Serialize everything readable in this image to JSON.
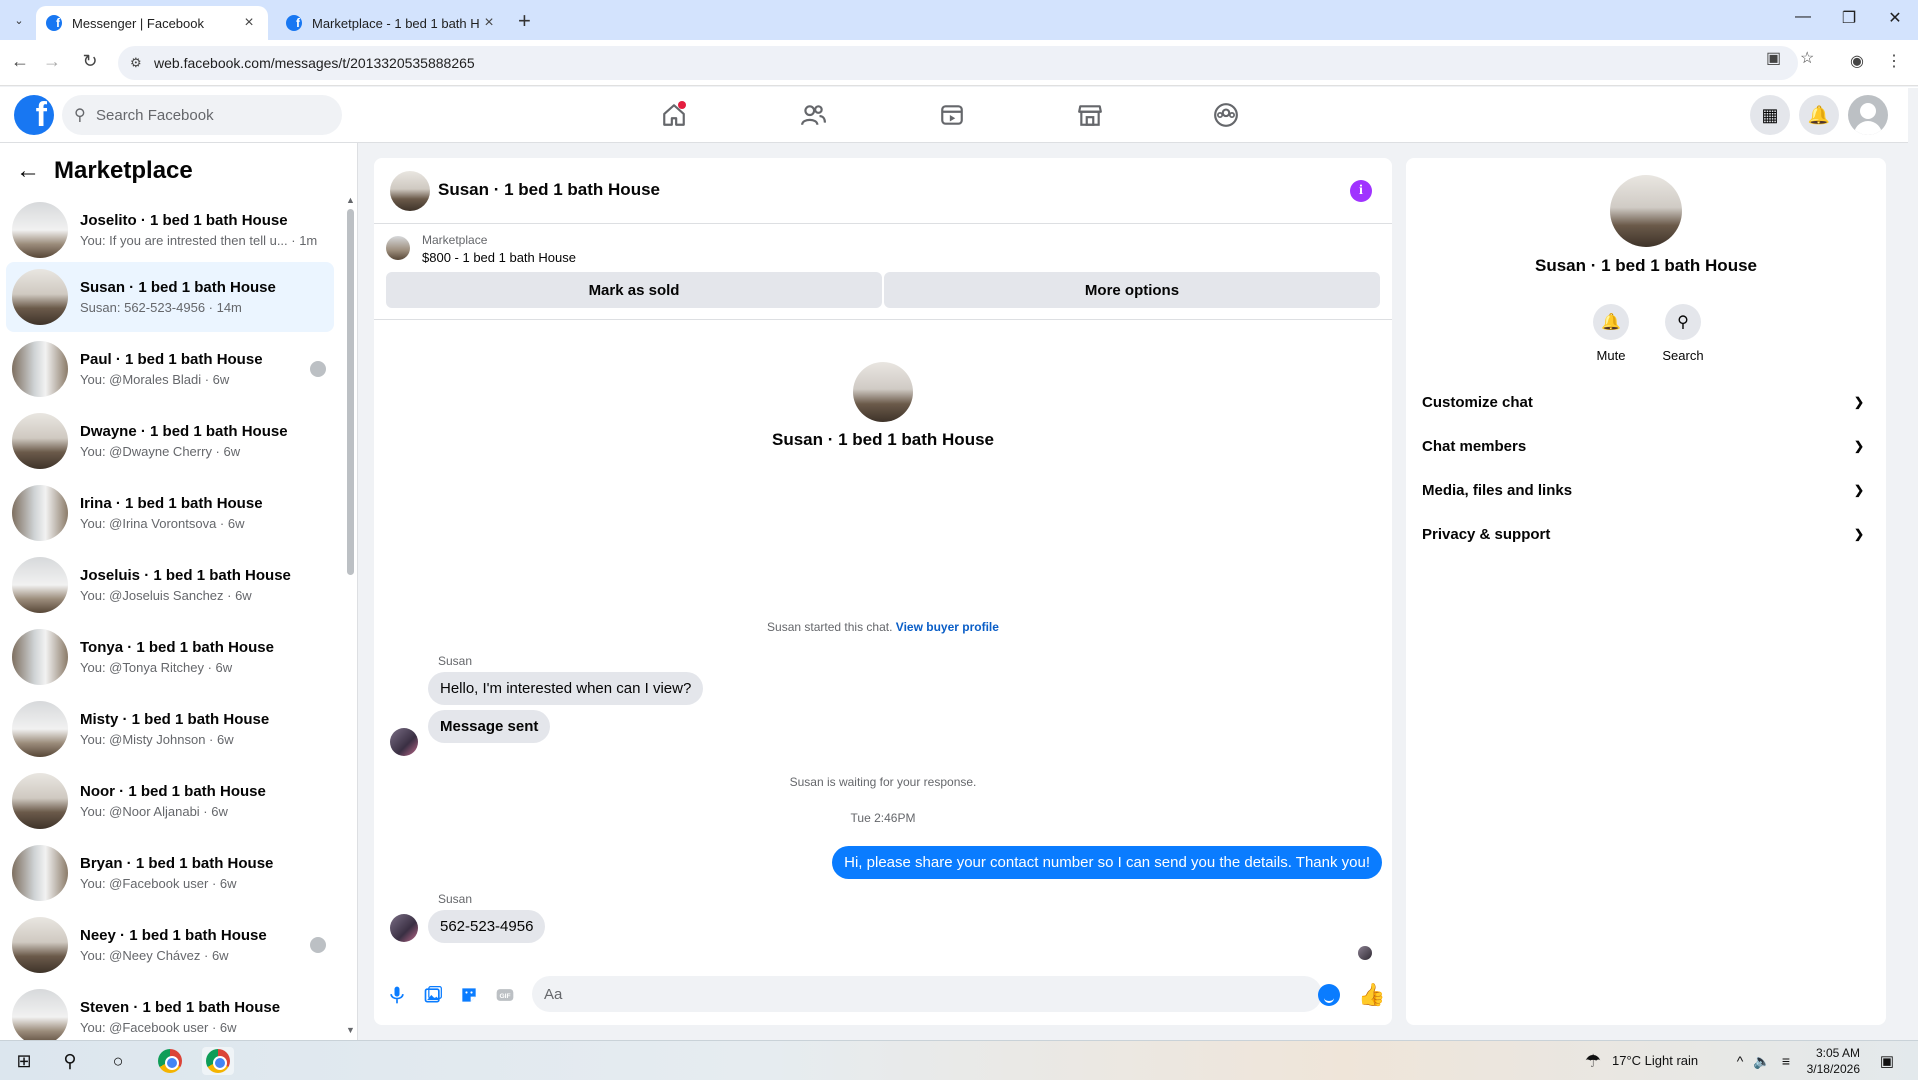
{
  "browser": {
    "tabs": [
      {
        "title": "Messenger | Facebook",
        "active": true
      },
      {
        "title": "Marketplace - 1 bed 1 bath Ho",
        "active": false
      }
    ],
    "url": "web.facebook.com/messages/t/2013320535888265"
  },
  "fb": {
    "search_placeholder": "Search Facebook",
    "brand_color": "#1877f2"
  },
  "sidebar": {
    "title": "Marketplace",
    "conversations": [
      {
        "name": "Joselito · 1 bed 1 bath House",
        "sub": "You: If you are intrested then tell u... · 1m"
      },
      {
        "name": "Susan · 1 bed 1 bath House",
        "sub": "Susan: 562-523-4956 · 14m"
      },
      {
        "name": "Paul · 1 bed 1 bath House",
        "sub": "You: @Morales Bladi · 6w"
      },
      {
        "name": "Dwayne · 1 bed 1 bath House",
        "sub": "You: @Dwayne Cherry · 6w"
      },
      {
        "name": "Irina · 1 bed 1 bath House",
        "sub": "You: @Irina Vorontsova · 6w"
      },
      {
        "name": "Joseluis · 1 bed 1 bath House",
        "sub": "You: @Joseluis Sanchez · 6w"
      },
      {
        "name": "Tonya · 1 bed 1 bath House",
        "sub": "You: @Tonya Ritchey · 6w"
      },
      {
        "name": "Misty · 1 bed 1 bath House",
        "sub": "You: @Misty Johnson · 6w"
      },
      {
        "name": "Noor · 1 bed 1 bath House",
        "sub": "You: @Noor Aljanabi · 6w"
      },
      {
        "name": "Bryan · 1 bed 1 bath House",
        "sub": "You: @Facebook user · 6w"
      },
      {
        "name": "Neey · 1 bed 1 bath House",
        "sub": "You: @Neey Chávez · 6w"
      },
      {
        "name": "Steven · 1 bed 1 bath House",
        "sub": "You: @Facebook user · 6w"
      }
    ]
  },
  "chat": {
    "title": "Susan · 1 bed 1 bath House",
    "listing_source": "Marketplace",
    "listing_price": "$800 - 1 bed 1 bath House",
    "mark_sold": "Mark as sold",
    "more_options": "More options",
    "intro_name": "Susan · 1 bed 1 bath House",
    "started_text": "Susan started this chat.",
    "view_buyer": "View buyer profile",
    "sender1": "Susan",
    "msg1": "Hello, I'm interested when can I view?",
    "msg2": "Message sent",
    "waiting": "Susan is waiting for your response.",
    "timestamp": "Tue 2:46PM",
    "out_msg": "Hi, please share your contact number so I can send you the details. Thank you!",
    "sender2": "Susan",
    "msg3": "562-523-4956",
    "composer_placeholder": "Aa",
    "accent_color": "#0a7cff"
  },
  "details": {
    "name": "Susan · 1 bed 1 bath House",
    "mute": "Mute",
    "search": "Search",
    "sections": [
      "Customize chat",
      "Chat members",
      "Media, files and links",
      "Privacy & support"
    ]
  },
  "taskbar": {
    "weather": "17°C  Light rain",
    "time": "3:05 AM",
    "date": "3/18/2026"
  }
}
